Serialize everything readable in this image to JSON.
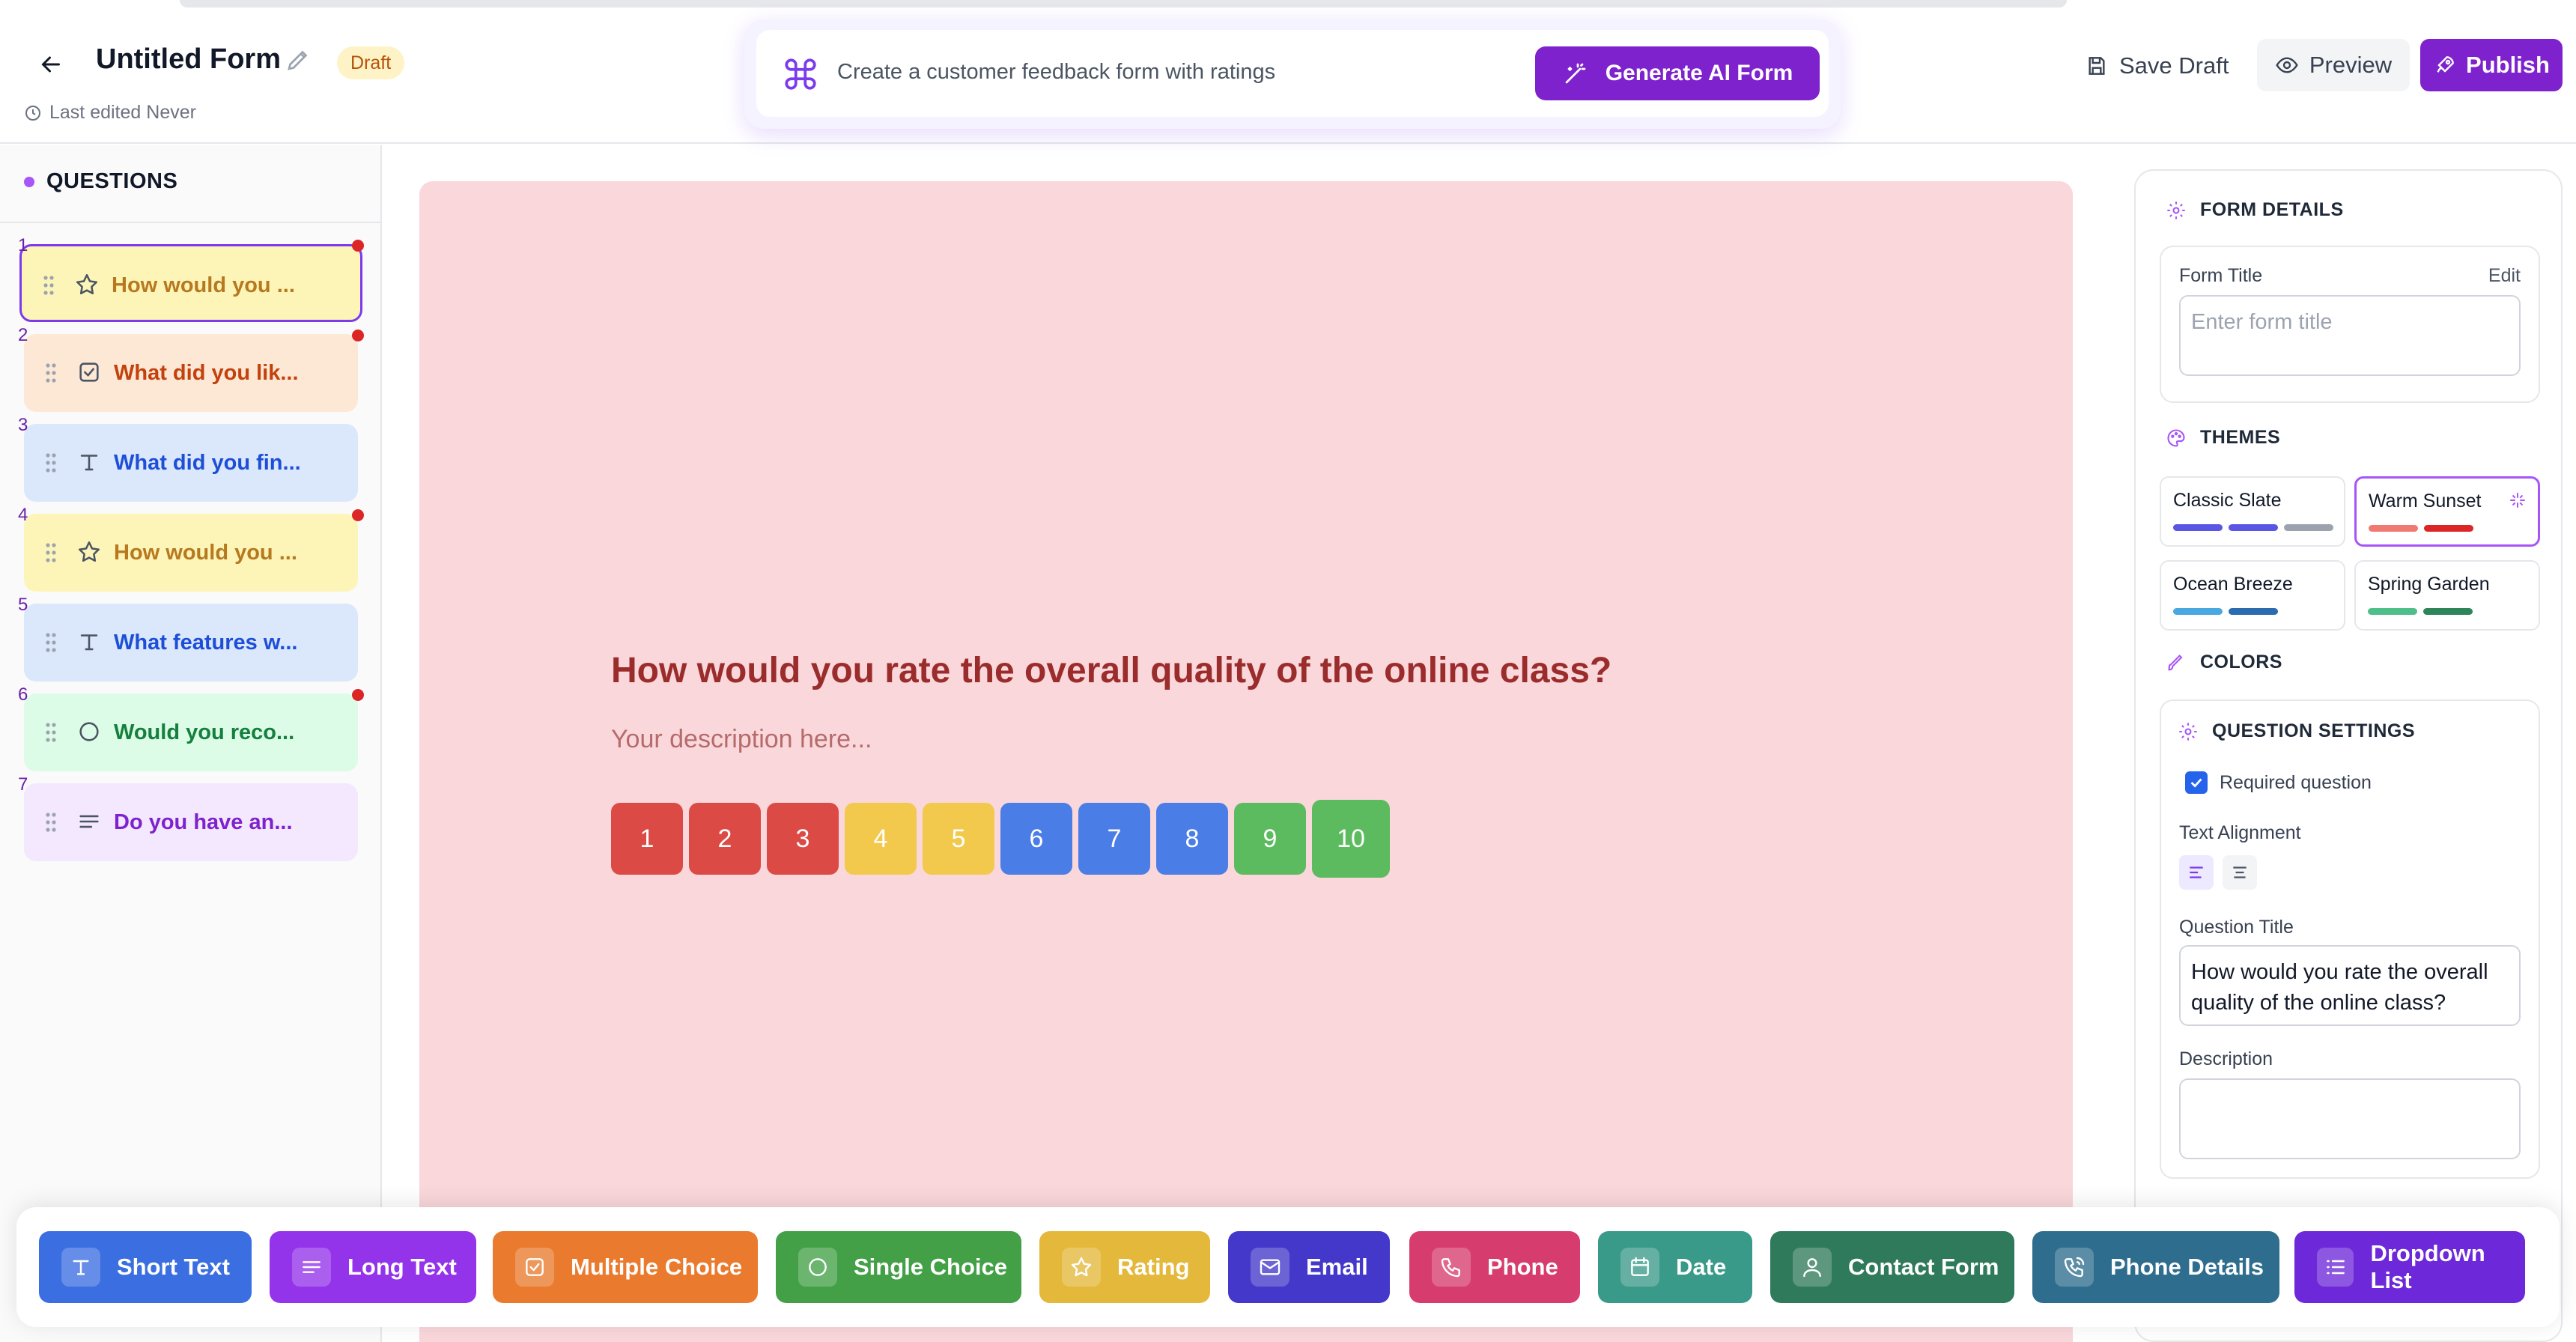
{
  "header": {
    "title": "Untitled Form",
    "badge": "Draft",
    "last_edited": "Last edited Never",
    "ai_placeholder": "Create a customer feedback form with ratings",
    "ai_button": "Generate AI Form",
    "save_draft": "Save Draft",
    "preview": "Preview",
    "publish": "Publish"
  },
  "sidebar": {
    "heading": "QUESTIONS",
    "items": [
      {
        "num": "1",
        "text": "How would you ...",
        "icon": "star-icon",
        "bg": "#fdf5b8",
        "fg": "#b7791f"
      },
      {
        "num": "2",
        "text": "What did you lik...",
        "icon": "checkbox-icon",
        "bg": "#fde8d5",
        "fg": "#c2410c"
      },
      {
        "num": "3",
        "text": "What did you fin...",
        "icon": "text-icon",
        "bg": "#dbe7fb",
        "fg": "#1d4ed8"
      },
      {
        "num": "4",
        "text": "How would you ...",
        "icon": "star-icon",
        "bg": "#fdf5b8",
        "fg": "#b7791f"
      },
      {
        "num": "5",
        "text": "What features w...",
        "icon": "text-icon",
        "bg": "#dbe7fb",
        "fg": "#1d4ed8"
      },
      {
        "num": "6",
        "text": "Would you reco...",
        "icon": "circle-icon",
        "bg": "#dcfce7",
        "fg": "#15803d"
      },
      {
        "num": "7",
        "text": "Do you have an...",
        "icon": "lines-icon",
        "bg": "#f3e8fd",
        "fg": "#7e22ce"
      }
    ]
  },
  "canvas": {
    "question": "How would you rate the overall quality of the online class?",
    "description": "Your description here...",
    "ratings": [
      {
        "label": "1",
        "color": "#dc4a45"
      },
      {
        "label": "2",
        "color": "#dc4a45"
      },
      {
        "label": "3",
        "color": "#dc4a45"
      },
      {
        "label": "4",
        "color": "#f2c94c"
      },
      {
        "label": "5",
        "color": "#f2c94c"
      },
      {
        "label": "6",
        "color": "#4a7de6"
      },
      {
        "label": "7",
        "color": "#4a7de6"
      },
      {
        "label": "8",
        "color": "#4a7de6"
      },
      {
        "label": "9",
        "color": "#5cbb5f"
      },
      {
        "label": "10",
        "color": "#5cbb5f"
      }
    ]
  },
  "panel": {
    "form_details": "FORM DETAILS",
    "form_title_label": "Form Title",
    "edit": "Edit",
    "form_title_placeholder": "Enter form title",
    "themes": "THEMES",
    "theme_items": [
      {
        "name": "Classic Slate",
        "colors": [
          "#5b55e6",
          "#5b55e6",
          "#9ca3af"
        ]
      },
      {
        "name": "Warm Sunset",
        "colors": [
          "#f07a72",
          "#dc2626",
          "#ffffff"
        ]
      },
      {
        "name": "Ocean Breeze",
        "colors": [
          "#4aa8e0",
          "#2b6cb0",
          "#ffffff"
        ]
      },
      {
        "name": "Spring Garden",
        "colors": [
          "#4fbf8a",
          "#2f855a",
          "#ffffff"
        ]
      }
    ],
    "colors": "COLORS",
    "question_settings": "QUESTION SETTINGS",
    "required": "Required question",
    "text_alignment": "Text Alignment",
    "question_title_label": "Question Title",
    "question_title_value": "How would you rate the overall quality of the online class?",
    "description_label": "Description"
  },
  "palette": [
    {
      "label": "Short Text",
      "icon": "text-icon",
      "color": "#3b6ee0"
    },
    {
      "label": "Long Text",
      "icon": "lines-icon",
      "color": "#9333ea"
    },
    {
      "label": "Multiple Choice",
      "icon": "checkbox-icon",
      "color": "#ea7a2e"
    },
    {
      "label": "Single Choice",
      "icon": "circle-icon",
      "color": "#43a047"
    },
    {
      "label": "Rating",
      "icon": "star-icon",
      "color": "#e4b83a"
    },
    {
      "label": "Email",
      "icon": "mail-icon",
      "color": "#4338ca"
    },
    {
      "label": "Phone",
      "icon": "phone-icon",
      "color": "#d63d6e"
    },
    {
      "label": "Date",
      "icon": "calendar-icon",
      "color": "#3a9a8a"
    },
    {
      "label": "Contact Form",
      "icon": "user-icon",
      "color": "#2f7a5a"
    },
    {
      "label": "Phone Details",
      "icon": "phone-details-icon",
      "color": "#2e6d8e"
    },
    {
      "label": "Dropdown List",
      "icon": "list-icon",
      "color": "#6d28d9"
    }
  ]
}
